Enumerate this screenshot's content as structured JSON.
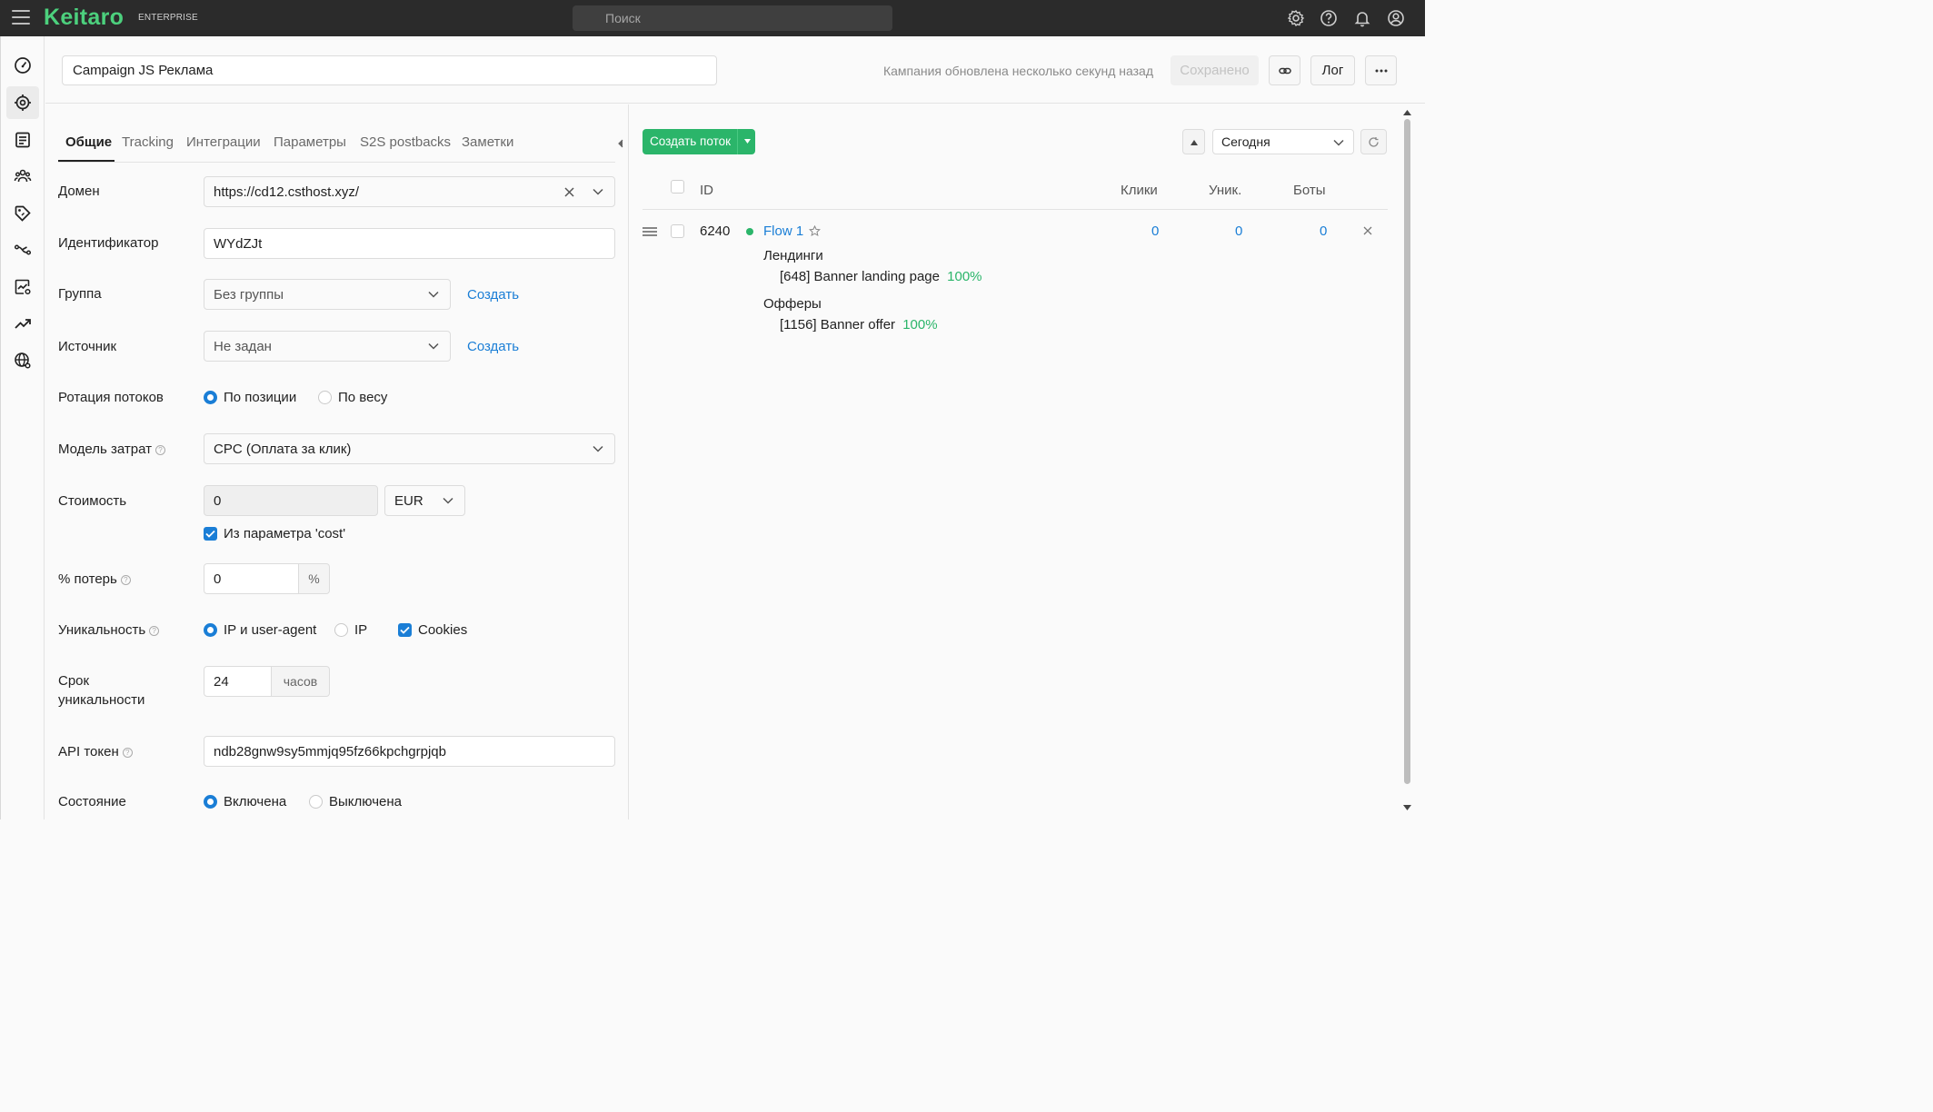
{
  "app": {
    "logo": "Keitaro",
    "edition": "ENTERPRISE"
  },
  "search": {
    "placeholder": "Поиск"
  },
  "header": {
    "campaign_name": "Campaign JS Реклама",
    "status": "Кампания обновлена несколько секунд назад",
    "saved_label": "Сохранено",
    "log_label": "Лог"
  },
  "tabs": [
    "Общие",
    "Tracking",
    "Интеграции",
    "Параметры",
    "S2S postbacks",
    "Заметки"
  ],
  "form": {
    "domain": {
      "label": "Домен",
      "value": "https://cd12.csthost.xyz/"
    },
    "identifier": {
      "label": "Идентификатор",
      "value": "WYdZJt"
    },
    "group": {
      "label": "Группа",
      "value": "Без группы",
      "create": "Создать"
    },
    "source": {
      "label": "Источник",
      "value": "Не задан",
      "create": "Создать"
    },
    "rotation": {
      "label": "Ротация потоков",
      "option1": "По позиции",
      "option2": "По весу"
    },
    "cost_model": {
      "label": "Модель затрат",
      "value": "CPC (Оплата за клик)"
    },
    "cost": {
      "label": "Стоимость",
      "value": "0",
      "currency": "EUR",
      "from_param": "Из параметра 'cost'"
    },
    "loss": {
      "label": "% потерь",
      "value": "0",
      "suffix": "%"
    },
    "uniqueness": {
      "label": "Уникальность",
      "option1": "IP и user-agent",
      "option2": "IP",
      "option3": "Cookies"
    },
    "unique_term": {
      "label1": "Срок",
      "label2": "уникальности",
      "value": "24",
      "suffix": "часов"
    },
    "api_token": {
      "label": "API токен",
      "value": "ndb28gnw9sy5mmjq95fz66kpchgrpjqb"
    },
    "state": {
      "label": "Состояние",
      "option1": "Включена",
      "option2": "Выключена"
    }
  },
  "flows": {
    "create_label": "Создать поток",
    "period": "Сегодня",
    "columns": {
      "id": "ID",
      "clicks": "Клики",
      "unique": "Уник.",
      "bots": "Боты"
    },
    "rows": [
      {
        "id": "6240",
        "name": "Flow 1",
        "clicks": "0",
        "unique": "0",
        "bots": "0",
        "landings_title": "Лендинги",
        "landing": "[648] Banner landing page",
        "landing_share": "100%",
        "offers_title": "Офферы",
        "offer": "[1156] Banner offer",
        "offer_share": "100%"
      }
    ]
  },
  "colors": {
    "accent": "#1a7ed6",
    "brand": "#4cd07d",
    "success": "#2bb56a",
    "topbar": "#2b2b2b"
  }
}
